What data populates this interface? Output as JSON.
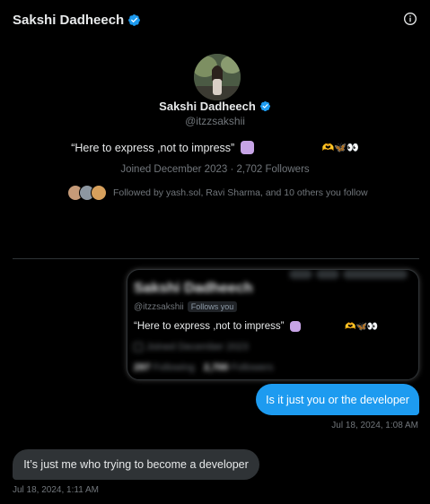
{
  "header": {
    "title": "Sakshi Dadheech",
    "verified_icon": "verified-badge-icon",
    "info_icon": "info-icon"
  },
  "profile": {
    "name": "Sakshi Dadheech",
    "handle": "@itzzsakshii",
    "bio": "“Here to express ,not to impress”",
    "bio_trailing_emoji": "🫶🦋👀",
    "joined_followers": "Joined December 2023 · 2,702 Followers",
    "followed_by": "Followed by yash.sol, Ravi Sharma, and 10 others you follow"
  },
  "shared_card": {
    "name": "Sakshi Dadheech",
    "handle": "@itzzsakshii",
    "follows_you": "Follows you",
    "bio": "“Here to express ,not to impress”",
    "bio_trailing_emoji": "🫶🦋👀",
    "joined": "Joined December 2023",
    "following_count": "297",
    "following_label": "Following",
    "followers_count": "2,700",
    "followers_label": "Followers"
  },
  "messages": [
    {
      "direction": "sent",
      "text": "Is it just you or the developer",
      "time": "Jul 18, 2024, 1:08 AM"
    },
    {
      "direction": "received",
      "text": "It’s just me who trying to become a developer",
      "time": "Jul 18, 2024, 1:11 AM"
    }
  ],
  "colors": {
    "background": "#000000",
    "accent": "#1d9bf0",
    "received_bubble": "#2f3336",
    "muted_text": "#71767b"
  }
}
